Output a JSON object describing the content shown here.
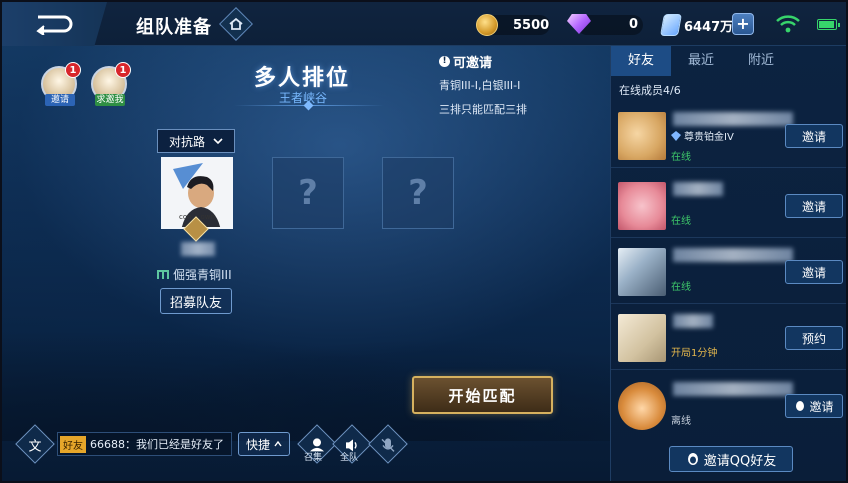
{
  "header": {
    "title": "组队准备",
    "gold": "5500",
    "diamonds": "0",
    "coupons": "6447万"
  },
  "left": {
    "quick_invite_label": "邀请",
    "quick_invite_badge": "1",
    "quick_request_label": "求邀我",
    "quick_request_badge": "1",
    "mode_title": "多人排位",
    "mode_subtitle": "王者峡谷",
    "invite_info": {
      "heading": "可邀请",
      "line1": "青铜III-I,白银III-I",
      "line2": "三排只能匹配三排"
    },
    "lane_select": "对抗路",
    "player_caption": "con... own",
    "player_rank": "倔强青铜III",
    "recruit_button": "招募队友",
    "empty_slot_symbol": "?",
    "start_button": "开始匹配"
  },
  "bottom": {
    "voice_to_text_glyph": "文",
    "chat_tag": "好友",
    "chat_message": "66688：我们已经是好友了",
    "quick_button": "快捷",
    "summon_label": "召集",
    "team_voice_label": "全队"
  },
  "panel": {
    "tabs": [
      "好友",
      "最近",
      "附近"
    ],
    "online_label": "在线成员4/6",
    "friends": [
      {
        "rank": "尊贵铂金IV",
        "status": "在线",
        "status_color": "#3ec96a",
        "action": "邀请"
      },
      {
        "rank": "",
        "status": "在线",
        "status_color": "#3ec96a",
        "action": "邀请"
      },
      {
        "rank": "",
        "status": "在线",
        "status_color": "#3ec96a",
        "action": "邀请"
      },
      {
        "rank": "",
        "status": "开局1分钟",
        "status_color": "#e3b74d",
        "action": "预约"
      },
      {
        "rank": "",
        "status": "离线",
        "status_color": "#c9d3df",
        "action": "邀请"
      }
    ],
    "qq_button": "邀请QQ好友"
  }
}
